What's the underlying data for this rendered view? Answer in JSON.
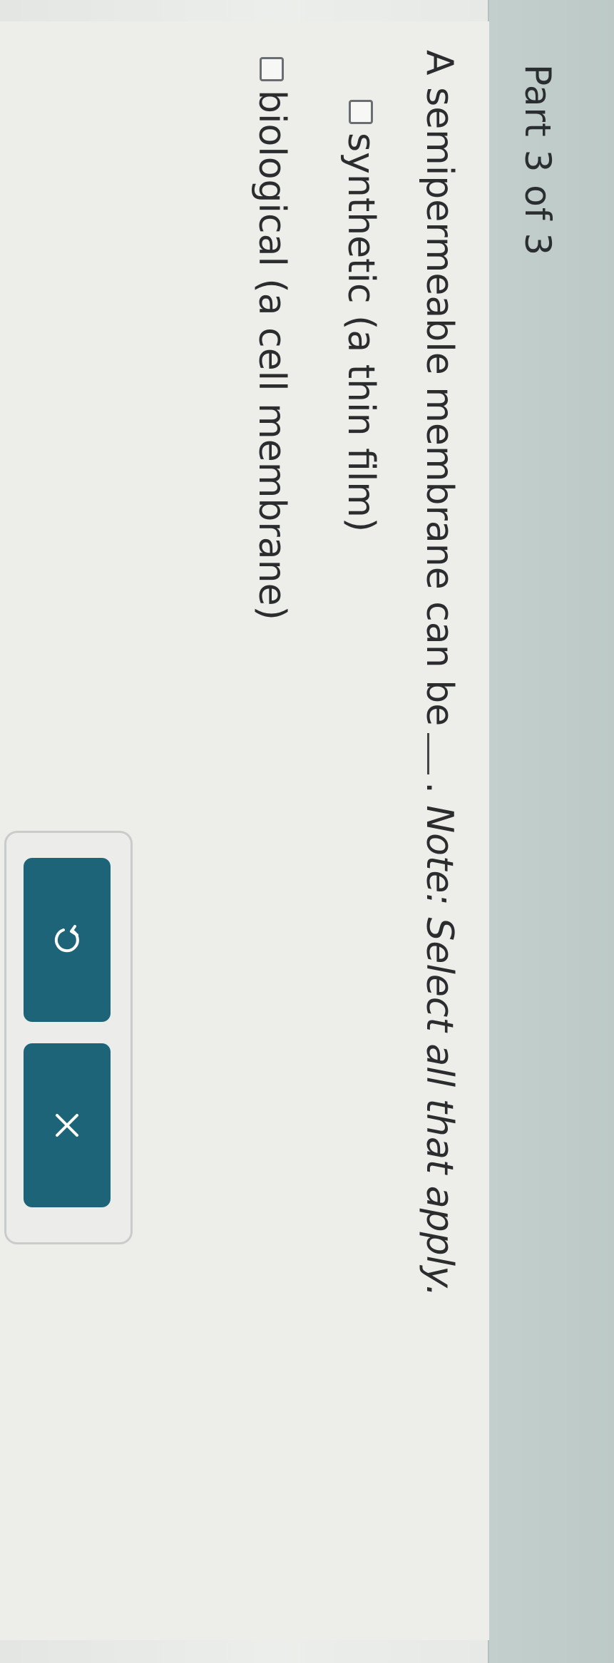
{
  "header": {
    "part_label": "Part 3 of 3"
  },
  "question": {
    "prefix": "A semipermeable membrane can be",
    "suffix": ".",
    "note": "Note: Select all that apply."
  },
  "options": [
    {
      "label": "synthetic (a thin film)",
      "checked": false
    },
    {
      "label": "biological (a cell membrane)",
      "checked": false
    }
  ],
  "buttons": {
    "undo_icon": "undo-icon",
    "clear_icon": "close-icon"
  },
  "colors": {
    "button": "#1e6479",
    "header": "#c3cfcd"
  }
}
